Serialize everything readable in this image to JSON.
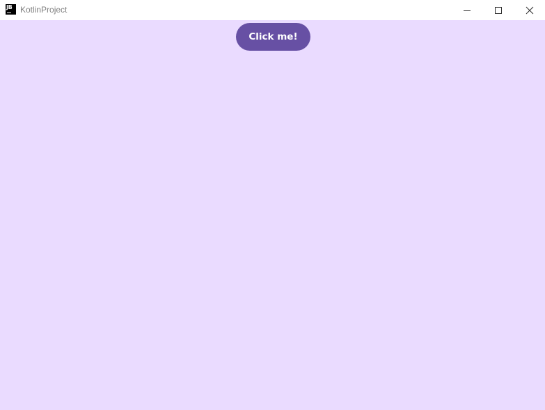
{
  "window": {
    "title": "KotlinProject",
    "app_icon": {
      "name": "jetbrains-icon",
      "text": "JB"
    },
    "controls": {
      "minimize_icon": "minimize-icon",
      "maximize_icon": "maximize-icon",
      "close_icon": "close-icon"
    }
  },
  "main": {
    "button_label": "Click me!"
  },
  "colors": {
    "content_background": "#eadbff",
    "button_background": "#6750a4",
    "button_text": "#ffffff",
    "titlebar_background": "#ffffff",
    "title_text": "#808080"
  }
}
